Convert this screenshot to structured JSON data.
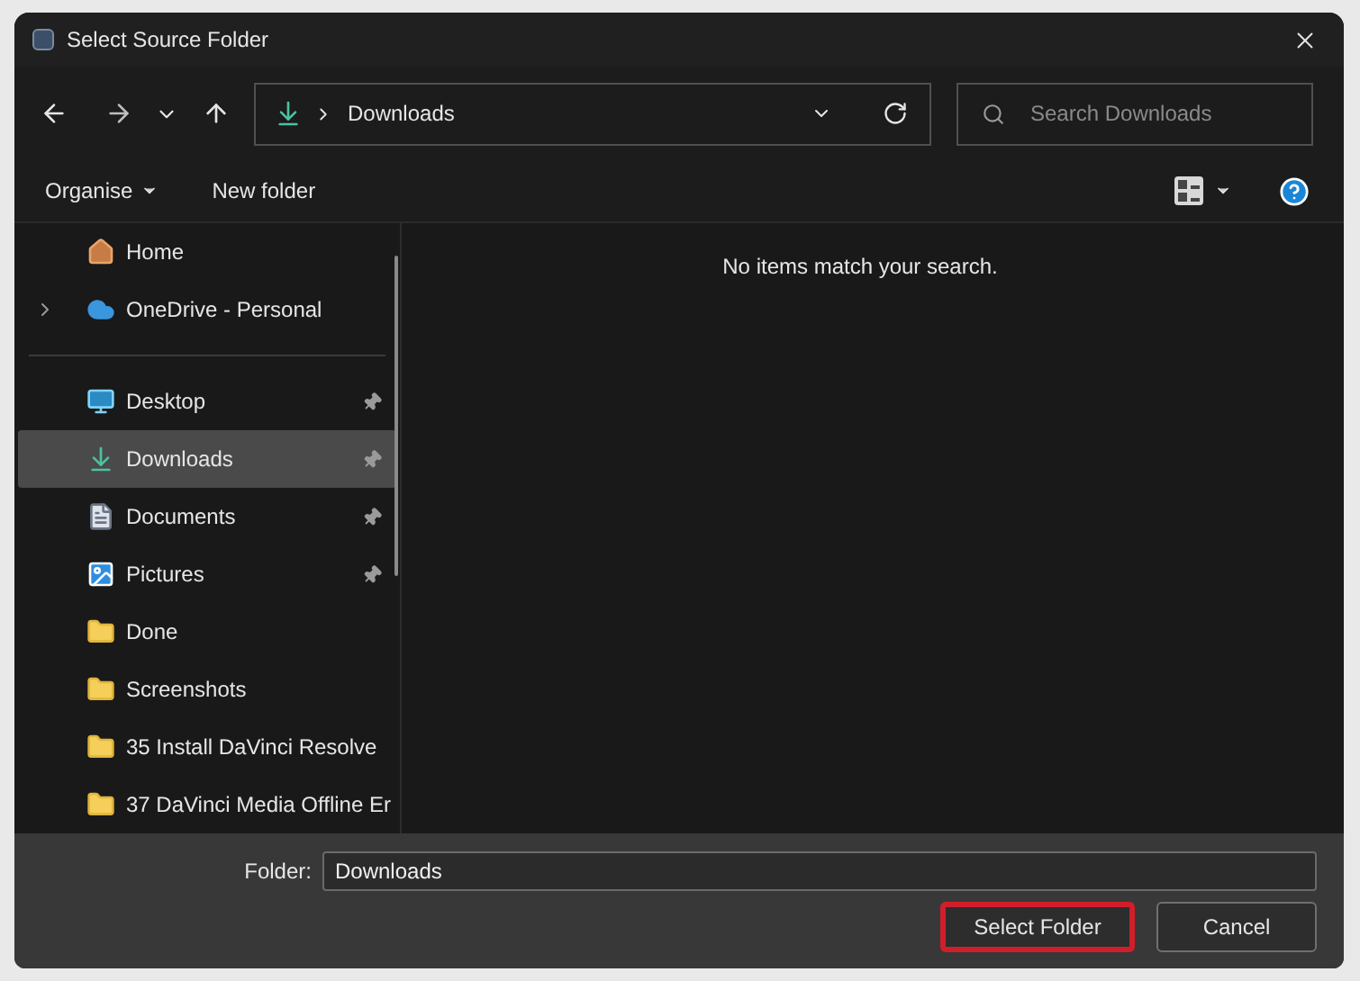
{
  "window": {
    "title": "Select Source Folder"
  },
  "navigation": {
    "address": "Downloads",
    "search_placeholder": "Search Downloads"
  },
  "commands": [
    {
      "label": "Organise",
      "kind": "menu"
    },
    {
      "label": "New folder",
      "kind": "button"
    }
  ],
  "sidebar": {
    "items": [
      {
        "label": "Home",
        "kind": "home",
        "pinned": false,
        "selected": false,
        "expandable": false
      },
      {
        "label": "OneDrive - Personal",
        "kind": "cloud",
        "pinned": false,
        "selected": false,
        "expandable": true
      },
      {
        "label": "Desktop",
        "kind": "desktop",
        "pinned": true,
        "selected": false,
        "expandable": false
      },
      {
        "label": "Downloads",
        "kind": "downloads",
        "pinned": true,
        "selected": true,
        "expandable": false
      },
      {
        "label": "Documents",
        "kind": "documents",
        "pinned": true,
        "selected": false,
        "expandable": false
      },
      {
        "label": "Pictures",
        "kind": "pictures",
        "pinned": true,
        "selected": false,
        "expandable": false
      },
      {
        "label": "Done",
        "kind": "folder",
        "pinned": false,
        "selected": false,
        "expandable": false
      },
      {
        "label": "Screenshots",
        "kind": "folder",
        "pinned": false,
        "selected": false,
        "expandable": false
      },
      {
        "label": "35 Install DaVinci Resolve",
        "kind": "folder",
        "pinned": false,
        "selected": false,
        "expandable": false
      },
      {
        "label": "37 DaVinci Media Offline Er",
        "kind": "folder",
        "pinned": false,
        "selected": false,
        "expandable": false
      }
    ]
  },
  "content": {
    "message": "No items match your search."
  },
  "footer": {
    "folder_label": "Folder:",
    "folder_value": "Downloads",
    "buttons": [
      {
        "label": "Select Folder",
        "highlighted": true
      },
      {
        "label": "Cancel",
        "highlighted": false
      }
    ]
  }
}
